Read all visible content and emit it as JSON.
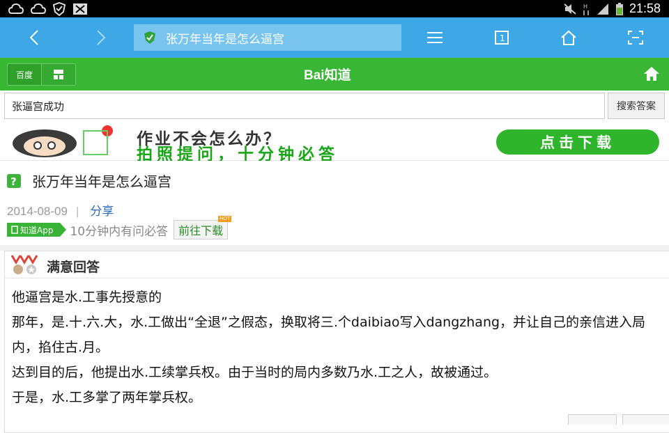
{
  "status_bar": {
    "time": "21:58"
  },
  "browser": {
    "url_title": "张万年当年是怎么逼宫"
  },
  "site": {
    "tabs": [
      {
        "label": "百度"
      },
      {
        "label": ""
      }
    ],
    "logo": "Bai知道"
  },
  "search": {
    "value": "张逼宫成功",
    "button": "搜索答案"
  },
  "banner": {
    "line1": "作业不会怎么办？",
    "line2": "拍照提问，十分钟必答",
    "button": "点击下载"
  },
  "question": {
    "title": "张万年当年是怎么逼宫",
    "date": "2014-08-09",
    "share": "分享",
    "app_badge": "知道App",
    "app_tip": "10分钟内有问必答",
    "goto_button": "前往下载",
    "hot": "HOT"
  },
  "answer": {
    "header": "满意回答",
    "lines": [
      "他逼宫是水.工事先授意的",
      "那年，是.十.六.大，水.工做出“全退”之假态，换取将三.个daibiao写入dangzhang，并让自己的亲信进入局内，掐住古.月。",
      "达到目的后，他提出水.工续掌兵权。由于当时的局内多数乃水.工之人，故被通过。",
      "于是，水.工多掌了两年掌兵权。"
    ]
  },
  "colors": {
    "browser_bar": "#3ea8e6",
    "site_green": "#38b634",
    "link_blue": "#2a6cc0"
  }
}
